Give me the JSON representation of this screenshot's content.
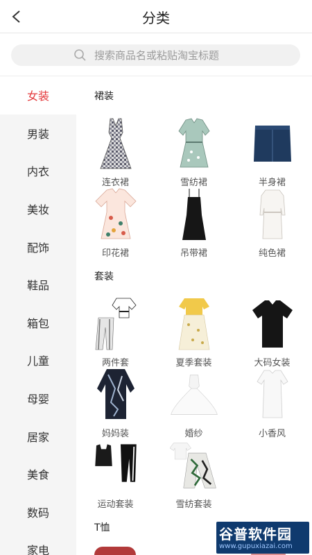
{
  "header": {
    "title": "分类"
  },
  "search": {
    "placeholder": "搜索商品名或粘贴淘宝标题"
  },
  "sidebar": {
    "items": [
      {
        "label": "女装",
        "active": true
      },
      {
        "label": "男装"
      },
      {
        "label": "内衣"
      },
      {
        "label": "美妆"
      },
      {
        "label": "配饰"
      },
      {
        "label": "鞋品"
      },
      {
        "label": "箱包"
      },
      {
        "label": "儿童"
      },
      {
        "label": "母婴"
      },
      {
        "label": "居家"
      },
      {
        "label": "美食"
      },
      {
        "label": "数码"
      },
      {
        "label": "家电"
      }
    ]
  },
  "sections": [
    {
      "title": "裙装",
      "items": [
        {
          "label": "连衣裙",
          "icon": "plaid-dress-image"
        },
        {
          "label": "雪纺裙",
          "icon": "chiffon-dress-image"
        },
        {
          "label": "半身裙",
          "icon": "denim-skirt-image"
        },
        {
          "label": "印花裙",
          "icon": "print-dress-image"
        },
        {
          "label": "吊带裙",
          "icon": "slip-dress-image"
        },
        {
          "label": "纯色裙",
          "icon": "white-dress-image"
        }
      ]
    },
    {
      "title": "套装",
      "items": [
        {
          "label": "两件套",
          "icon": "two-piece-image"
        },
        {
          "label": "夏季套装",
          "icon": "summer-set-image"
        },
        {
          "label": "大码女装",
          "icon": "black-tee-image"
        },
        {
          "label": "妈妈装",
          "icon": "mom-wear-image"
        },
        {
          "label": "婚纱",
          "icon": "wedding-dress-image"
        },
        {
          "label": "小香风",
          "icon": "white-mini-dress-image"
        },
        {
          "label": "运动套装",
          "icon": "sport-set-image"
        },
        {
          "label": "雪纺套装",
          "icon": "chiffon-set-image"
        }
      ]
    },
    {
      "title": "T恤"
    }
  ],
  "watermark": {
    "title": "谷普软件园",
    "url": "www.gupuxiazai.com"
  },
  "colors": {
    "accent": "#e4393c",
    "sidebar_bg": "#f5f5f5"
  }
}
